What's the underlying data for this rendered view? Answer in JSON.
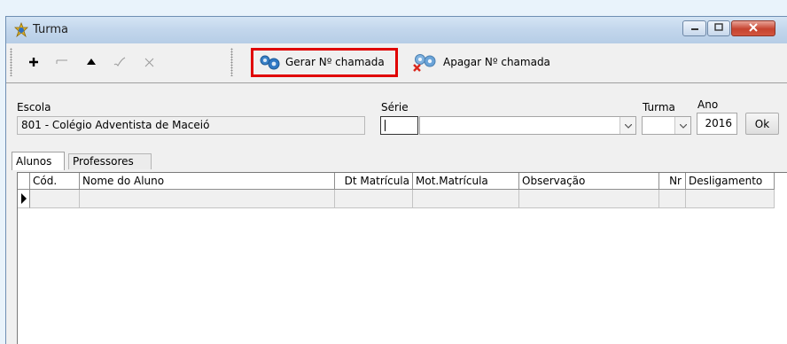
{
  "window": {
    "title": "Turma",
    "title_icon": "turma-app-icon",
    "controls": [
      "minimize-icon",
      "maximize-icon",
      "close-icon"
    ]
  },
  "toolbar": {
    "icon_buttons": [
      {
        "name": "add-button",
        "icon": "plus-icon",
        "enabled": true
      },
      {
        "name": "delete-button",
        "icon": "minus-icon",
        "enabled": false
      },
      {
        "name": "edit-button",
        "icon": "triangle-up-icon",
        "enabled": true
      },
      {
        "name": "confirm-button",
        "icon": "check-icon",
        "enabled": false
      },
      {
        "name": "cancel-button",
        "icon": "x-icon",
        "enabled": false
      }
    ],
    "gerar_label": "Gerar Nº chamada",
    "apagar_label": "Apagar Nº chamada",
    "highlight_color": "#e00000"
  },
  "form": {
    "escola_label": "Escola",
    "escola_value": "801 - Colégio Adventista de Maceió",
    "serie_label": "Série",
    "serie_code_value": "",
    "serie_value": "",
    "turma_label": "Turma",
    "turma_value": "",
    "ano_label": "Ano",
    "ano_value": "2016",
    "ok_label": "Ok"
  },
  "tabs": [
    {
      "label": "Alunos",
      "active": true
    },
    {
      "label": "Professores",
      "active": false
    }
  ],
  "grid": {
    "columns": [
      "Cód.",
      "Nome do Aluno",
      "Dt Matrícula",
      "Mot.Matrícula",
      "Observação",
      "Nr",
      "Desligamento"
    ],
    "rows": [
      [
        "",
        "",
        "",
        "",
        "",
        "",
        ""
      ]
    ]
  }
}
